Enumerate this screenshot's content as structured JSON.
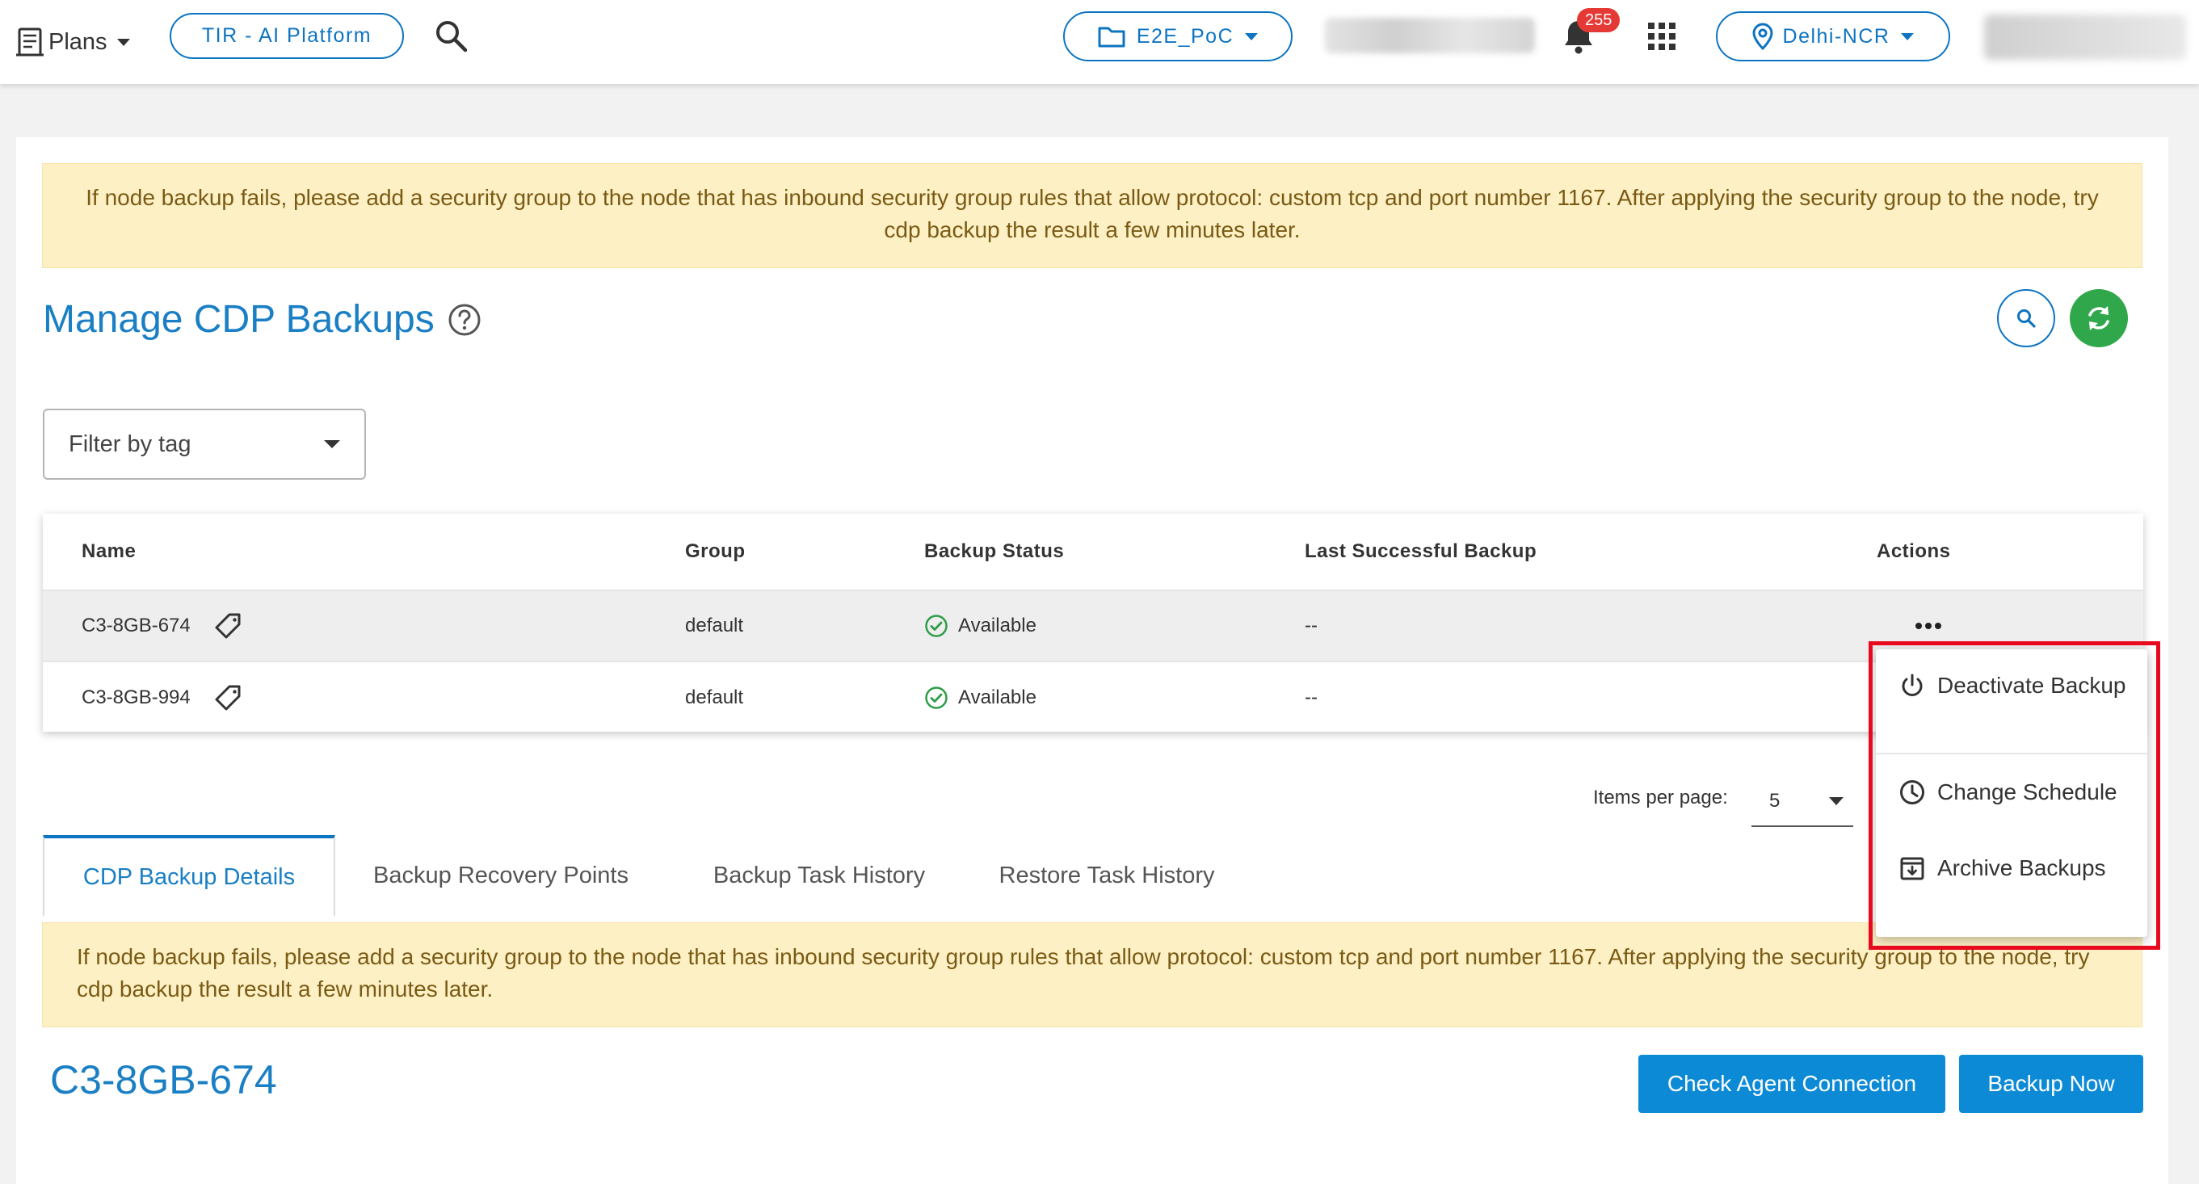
{
  "header": {
    "plans_label": "Plans",
    "platform_label": "TIR - AI Platform",
    "project_label": "E2E_PoC",
    "notification_count": "255",
    "region_label": "Delhi-NCR"
  },
  "alerts": {
    "top_message": "If node backup fails, please add a security group to the node that has inbound security group rules that allow protocol: custom tcp and port number 1167. After applying the security group to the node, try cdp backup the result a few minutes later.",
    "bottom_message": "If node backup fails, please add a security group to the node that has inbound security group rules that allow protocol: custom tcp and port number 1167. After applying the security group to the node, try cdp backup the result a few minutes later."
  },
  "page": {
    "title": "Manage CDP Backups"
  },
  "filter": {
    "placeholder": "Filter by tag"
  },
  "table": {
    "headers": {
      "name": "Name",
      "group": "Group",
      "backup_status": "Backup Status",
      "last_successful_backup": "Last Successful Backup",
      "actions": "Actions"
    },
    "rows": [
      {
        "name": "C3-8GB-674",
        "group": "default",
        "status": "Available",
        "last_backup": "--"
      },
      {
        "name": "C3-8GB-994",
        "group": "default",
        "status": "Available",
        "last_backup": "--"
      }
    ]
  },
  "pagination": {
    "items_per_page_label": "Items per page:",
    "items_per_page_value": "5"
  },
  "tabs": [
    {
      "label": "CDP Backup Details",
      "active": true
    },
    {
      "label": "Backup Recovery Points",
      "active": false
    },
    {
      "label": "Backup Task History",
      "active": false
    },
    {
      "label": "Restore Task History",
      "active": false
    }
  ],
  "details": {
    "node_title": "C3-8GB-674",
    "check_agent_label": "Check Agent Connection",
    "backup_now_label": "Backup Now"
  },
  "actions_menu": {
    "items": [
      {
        "label": "Deactivate Backup",
        "icon": "power-icon"
      },
      {
        "label": "Change Schedule",
        "icon": "clock-icon"
      },
      {
        "label": "Archive Backups",
        "icon": "archive-icon"
      }
    ]
  },
  "colors": {
    "primary": "#0d74c1",
    "title_blue": "#1a7fc4",
    "button_blue": "#0d8ad6",
    "refresh_green": "#30a74a",
    "alert_bg": "#fdf0c4",
    "alert_text": "#7a5a14",
    "badge_red": "#e53935",
    "highlight_red": "#e8091e",
    "available_green": "#2e9d48"
  }
}
